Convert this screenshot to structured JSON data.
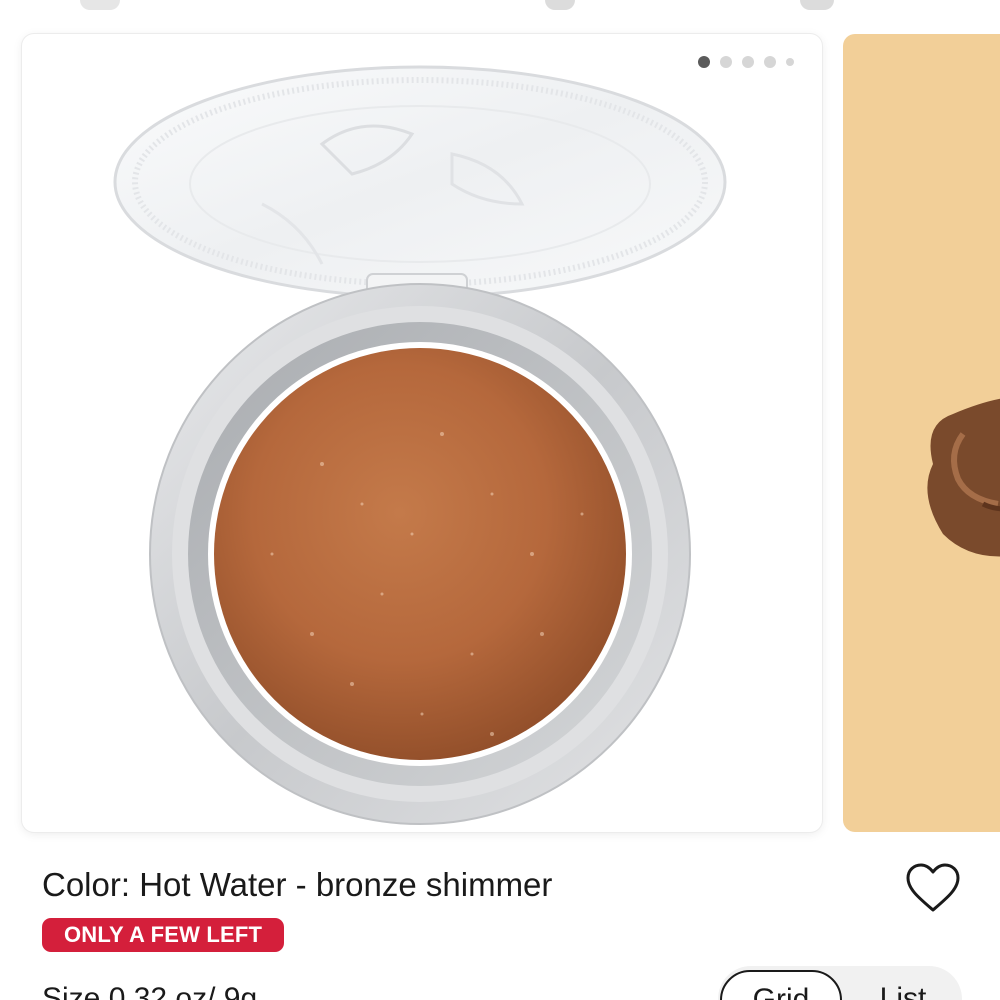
{
  "product": {
    "color_label": "Color: Hot Water - bronze shimmer",
    "stock_badge": "ONLY A FEW LEFT",
    "size_text": "Size 0.32 oz/ 9g"
  },
  "carousel": {
    "total_slides": 5,
    "active_slide": 1
  },
  "view_toggle": {
    "grid_label": "Grid",
    "list_label": "List",
    "selected": "Grid"
  },
  "icons": {
    "wishlist": "heart-outline-icon"
  },
  "colors": {
    "badge_red": "#d41f3b",
    "next_card_bg": "#f2cf98",
    "bronze_pan": "#b5683c"
  }
}
